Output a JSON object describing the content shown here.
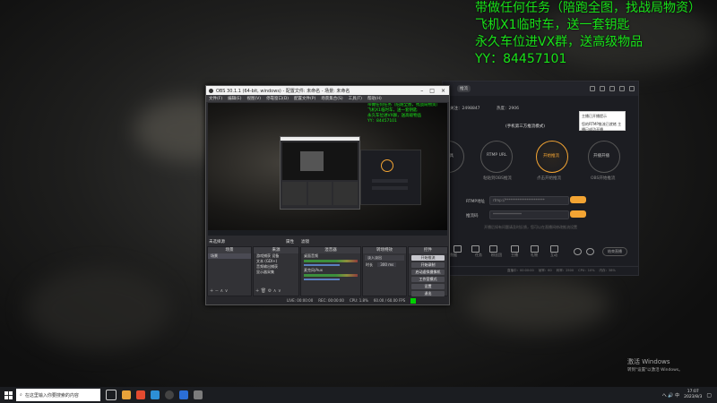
{
  "overlay": {
    "line1": "带做任何任务（陪跑全图，找战局物资）",
    "line2": "飞机X1临时车，送一套钥匙",
    "line3": "永久车位进VX群，送高级物品",
    "line4": "YY：84457101"
  },
  "obs": {
    "title": "OBS 30.1.1 (64-bit, windows) - 配置文件: 未命名 - 场景: 未命名",
    "menus": [
      "文件(F)",
      "编辑(E)",
      "视图(V)",
      "停靠窗口(D)",
      "配置文件(P)",
      "场景集合(S)",
      "工具(T)",
      "帮助(H)"
    ],
    "source_label": "未选择源",
    "props_button": "属性",
    "filters_button": "滤镜",
    "docks": {
      "scenes": {
        "title": "场景",
        "items": [
          "场景"
        ]
      },
      "sources": {
        "title": "来源",
        "items": [
          "游戏捕获 设备",
          "文本 (GDI+)",
          "音频输出捕获",
          "显示器采集"
        ]
      },
      "mixer": {
        "title": "混音器",
        "channels": [
          "桌面音频",
          "麦克风/Aux"
        ]
      },
      "transitions": {
        "title": "转场特效",
        "type": "淡入淡出",
        "duration_label": "时长",
        "duration": "300 ms"
      },
      "controls": {
        "title": "控件",
        "buttons": [
          "开始推流",
          "开始录制",
          "启动虚拟摄像机",
          "工作室模式",
          "设置",
          "退出"
        ]
      }
    },
    "status": [
      "LIVE: 00:00:00",
      "REC: 00:00:00",
      "CPU: 1.8%",
      "60.00 / 60.00 FPS"
    ],
    "preview_overlay": [
      "带做任何任务（陪跑全图，找战局物资）",
      "飞机X1临时车，送一套钥匙",
      "永久车位进VX群，送高级物品",
      "YY：84457101"
    ]
  },
  "bgapp": {
    "tab_label": "推流",
    "stat1": "关注：2498847",
    "stat2": "热度：2906",
    "mode_title": "(手机第三方推流模式)",
    "steps": [
      "推流工具",
      "RTMP URL",
      "开始推流",
      "开播开播"
    ],
    "step_sub": [
      "复制推流地址",
      "粘贴到OBS推流",
      "点击开始推流",
      "OBS开始推流"
    ],
    "field1_label": "RTMP地址",
    "field1_value": "rtmp://**********************",
    "field2_label": "推流码",
    "field2_value": "****************",
    "copy": "复制",
    "hint": "开播后如有问题请及时反馈，您可以在直播间修改推流设置",
    "tools": [
      "数据",
      "任务",
      "粉丝团",
      "主播",
      "礼物",
      "互动",
      "更多"
    ],
    "end_button": "结束直播",
    "footer": [
      "直播中：00:00:00",
      "帧率：60",
      "码率：2500",
      "CPU：10%",
      "内存：38%",
      "直播开播",
      "关注"
    ],
    "popup_lines": [
      "主播已开播提示",
      "您的RTMP推流已就绪 主播已成功开播"
    ]
  },
  "taskbar": {
    "search_placeholder": "在这里输入你要搜索的内容",
    "time": "17:07",
    "date": "2023/8/3",
    "lang": "中",
    "tray_text": "へ 🔊 中"
  },
  "watermark": {
    "line1": "激活 Windows",
    "line2": "转到\"设置\"以激活 Windows。"
  },
  "colors": {
    "overlay_green": "#19e319",
    "accent_orange": "#f3a433",
    "obs_bg": "#2b2b2f"
  }
}
